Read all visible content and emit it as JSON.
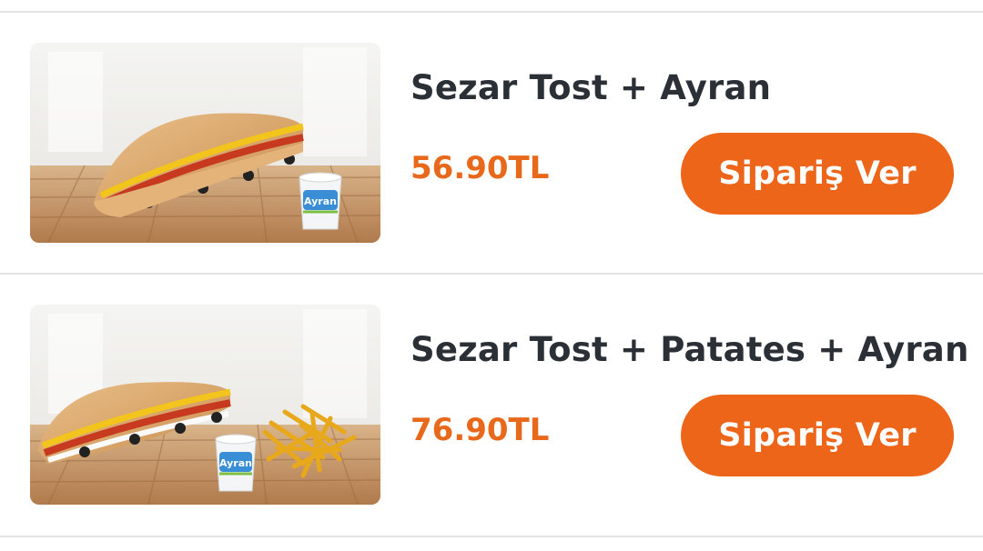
{
  "colors": {
    "accent": "#ec6519",
    "price": "#e8691b",
    "title": "#2b2f36",
    "divider": "#e3e3e3"
  },
  "products": [
    {
      "title": "Sezar Tost + Ayran",
      "price": "56.90TL",
      "button_label": "Sipariş Ver",
      "image_contents": [
        "toast",
        "ayran-cup"
      ],
      "cup_label": "Ayran"
    },
    {
      "title": "Sezar Tost + Patates + Ayran",
      "price": "76.90TL",
      "button_label": "Sipariş Ver",
      "image_contents": [
        "toast",
        "ayran-cup",
        "fries"
      ],
      "cup_label": "Ayran"
    }
  ]
}
